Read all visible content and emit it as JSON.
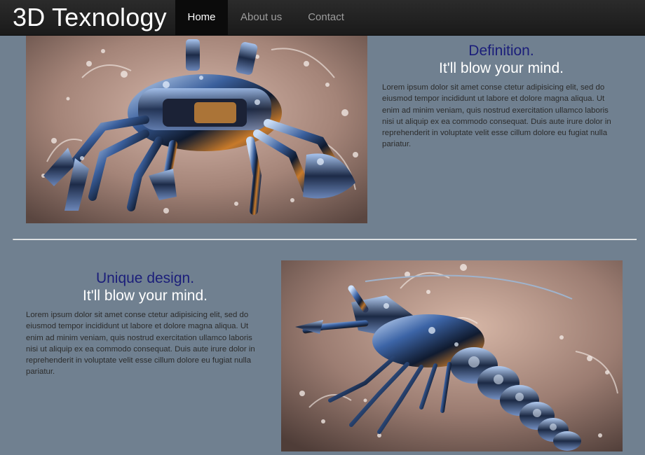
{
  "navbar": {
    "brand": "3D Texnology",
    "items": [
      {
        "label": "Home",
        "active": true
      },
      {
        "label": "About us",
        "active": false
      },
      {
        "label": "Contact",
        "active": false
      }
    ]
  },
  "features": [
    {
      "heading": "Definition.",
      "subheading": "It'll blow your mind.",
      "body": "Lorem ipsum dolor sit amet conse ctetur adipisicing elit, sed do eiusmod tempor incididunt ut labore et dolore magna aliqua. Ut enim ad minim veniam, quis nostrud exercitation ullamco laboris nisi ut aliquip ex ea commodo consequat. Duis aute irure dolor in reprehenderit in voluptate velit esse cillum dolore eu fugiat nulla pariatur.",
      "image": "robotic-crab-image"
    },
    {
      "heading": "Unique design.",
      "subheading": "It'll blow your mind.",
      "body": "Lorem ipsum dolor sit amet conse ctetur adipisicing elit, sed do eiusmod tempor incididunt ut labore et dolore magna aliqua. Ut enim ad minim veniam, quis nostrud exercitation ullamco laboris nisi ut aliquip ex ea commodo consequat. Duis aute irure dolor in reprehenderit in voluptate velit esse cillum dolore eu fugiat nulla pariatur.",
      "image": "robotic-shrimp-image"
    }
  ],
  "colors": {
    "page_background": "#708090",
    "navbar_background": "#222222",
    "active_nav_background": "#0b0b0b",
    "heading": "#1b1e7a",
    "subheading": "#ffffff",
    "body_text": "#2c2c2c"
  }
}
